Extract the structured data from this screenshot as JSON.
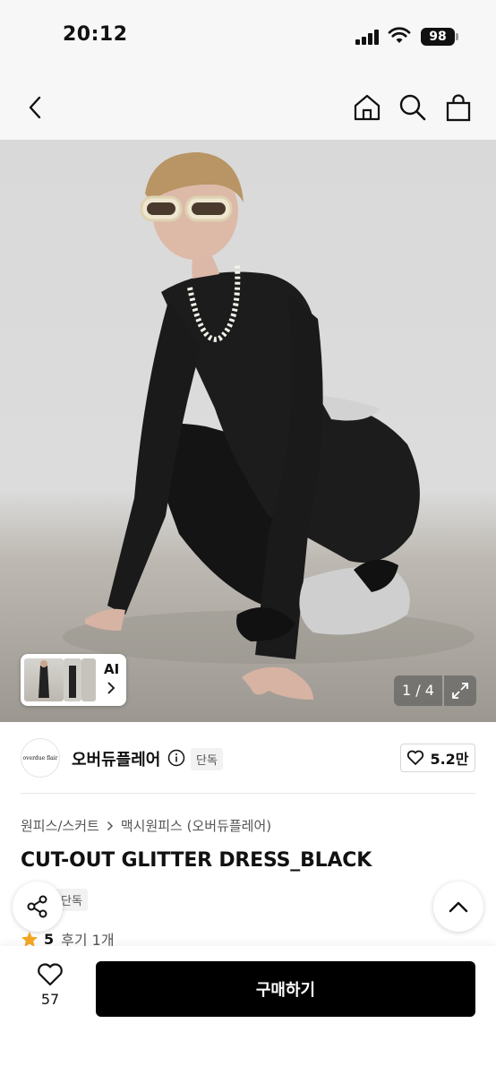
{
  "status_bar": {
    "time": "20:12",
    "battery": "98"
  },
  "nav": {
    "icons": [
      "back-icon",
      "home-icon",
      "search-icon",
      "shopping-bag-icon"
    ]
  },
  "gallery": {
    "ai_label": "AI",
    "page_indicator": "1 / 4"
  },
  "brand": {
    "logo_text": "overdue flair",
    "name": "오버듀플레어",
    "badge": "단독",
    "likes": "5.2만"
  },
  "breadcrumb": [
    "원피스/스커트",
    "맥시원피스 (오버듀플레어)"
  ],
  "product": {
    "title": "CUT-OUT GLITTER DRESS_BLACK",
    "badge": "단독",
    "rating": "5",
    "reviews": "후기 1개"
  },
  "bottom_bar": {
    "wish_count": "57",
    "buy_label": "구매하기"
  },
  "colors": {
    "primary": "#000000",
    "star": "#f5a623",
    "background": "#ffffff"
  }
}
